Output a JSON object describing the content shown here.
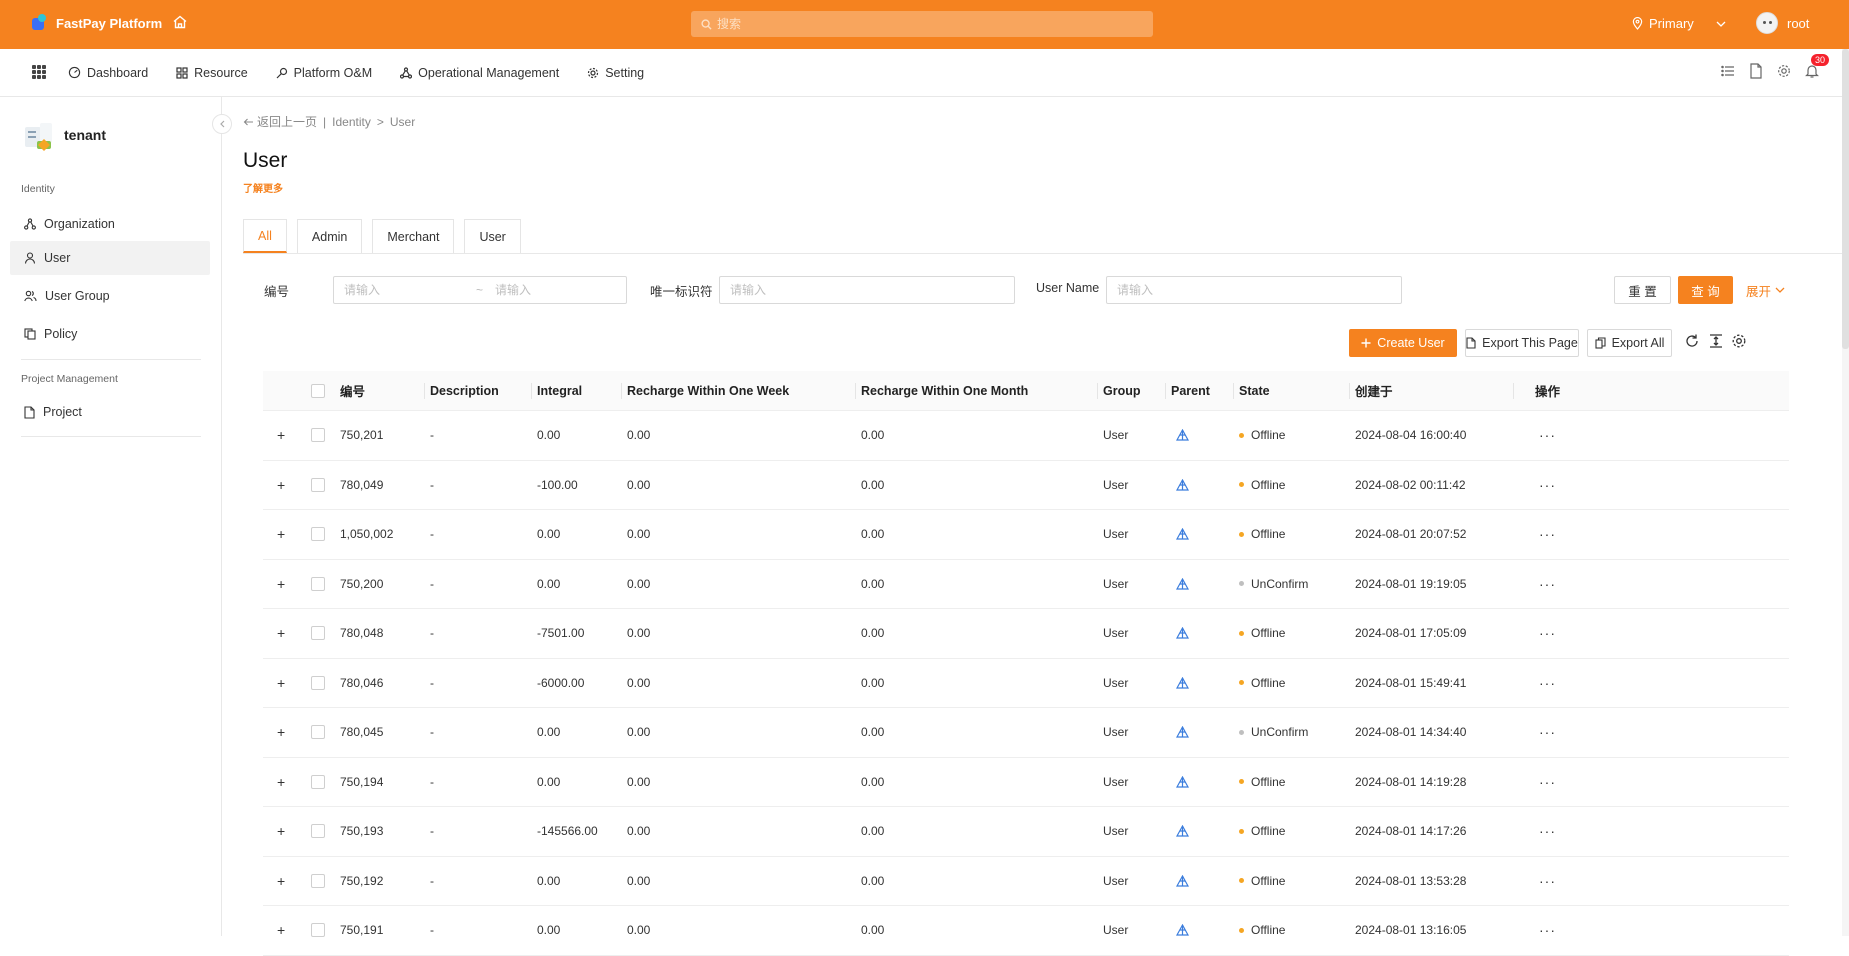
{
  "topbar": {
    "brand": "FastPay Platform",
    "search_placeholder": "搜索",
    "environment": "Primary",
    "username": "root"
  },
  "nav": {
    "items": [
      {
        "label": "Dashboard",
        "icon": "dashboard-icon"
      },
      {
        "label": "Resource",
        "icon": "resource-icon"
      },
      {
        "label": "Platform O&M",
        "icon": "platform-om-icon"
      },
      {
        "label": "Operational Management",
        "icon": "operational-icon"
      },
      {
        "label": "Setting",
        "icon": "gear-icon"
      }
    ],
    "notification_count": "30"
  },
  "sidebar": {
    "tenant": "tenant",
    "groups": [
      {
        "title": "Identity",
        "items": [
          {
            "label": "Organization",
            "icon": "organization-icon",
            "active": false
          },
          {
            "label": "User",
            "icon": "user-icon",
            "active": true
          },
          {
            "label": "User Group",
            "icon": "user-group-icon",
            "active": false
          },
          {
            "label": "Policy",
            "icon": "policy-icon",
            "active": false
          }
        ]
      },
      {
        "title": "Project Management",
        "items": [
          {
            "label": "Project",
            "icon": "project-icon",
            "active": false
          }
        ]
      }
    ]
  },
  "breadcrumb": {
    "back": "返回上一页",
    "separator": "|",
    "items": [
      "Identity",
      "User"
    ],
    "arrow": ">"
  },
  "page": {
    "title": "User",
    "learn_more": "了解更多"
  },
  "tabs": [
    {
      "label": "All",
      "active": true
    },
    {
      "label": "Admin",
      "active": false
    },
    {
      "label": "Merchant",
      "active": false
    },
    {
      "label": "User",
      "active": false
    }
  ],
  "filters": {
    "id_label": "编号",
    "id_from_placeholder": "请输入",
    "range_sep": "~",
    "id_to_placeholder": "请输入",
    "uid_label": "唯一标识符",
    "uid_placeholder": "请输入",
    "username_label": "User Name",
    "username_placeholder": "请输入",
    "reset": "重 置",
    "query": "查 询",
    "expand": "展开"
  },
  "toolbar": {
    "create": "Create User",
    "export_page": "Export This Page",
    "export_all": "Export All"
  },
  "table": {
    "columns": [
      "编号",
      "Description",
      "Integral",
      "Recharge Within One Week",
      "Recharge Within One Month",
      "Group",
      "Parent",
      "State",
      "创建于",
      "操作"
    ],
    "rows": [
      {
        "id": "750,201",
        "desc": "-",
        "integral": "0.00",
        "week": "0.00",
        "month": "0.00",
        "group": "User",
        "state": "Offline",
        "created": "2024-08-04 16:00:40"
      },
      {
        "id": "780,049",
        "desc": "-",
        "integral": "-100.00",
        "week": "0.00",
        "month": "0.00",
        "group": "User",
        "state": "Offline",
        "created": "2024-08-02 00:11:42"
      },
      {
        "id": "1,050,002",
        "desc": "-",
        "integral": "0.00",
        "week": "0.00",
        "month": "0.00",
        "group": "User",
        "state": "Offline",
        "created": "2024-08-01 20:07:52"
      },
      {
        "id": "750,200",
        "desc": "-",
        "integral": "0.00",
        "week": "0.00",
        "month": "0.00",
        "group": "User",
        "state": "UnConfirm",
        "created": "2024-08-01 19:19:05"
      },
      {
        "id": "780,048",
        "desc": "-",
        "integral": "-7501.00",
        "week": "0.00",
        "month": "0.00",
        "group": "User",
        "state": "Offline",
        "created": "2024-08-01 17:05:09"
      },
      {
        "id": "780,046",
        "desc": "-",
        "integral": "-6000.00",
        "week": "0.00",
        "month": "0.00",
        "group": "User",
        "state": "Offline",
        "created": "2024-08-01 15:49:41"
      },
      {
        "id": "780,045",
        "desc": "-",
        "integral": "0.00",
        "week": "0.00",
        "month": "0.00",
        "group": "User",
        "state": "UnConfirm",
        "created": "2024-08-01 14:34:40"
      },
      {
        "id": "750,194",
        "desc": "-",
        "integral": "0.00",
        "week": "0.00",
        "month": "0.00",
        "group": "User",
        "state": "Offline",
        "created": "2024-08-01 14:19:28"
      },
      {
        "id": "750,193",
        "desc": "-",
        "integral": "-145566.00",
        "week": "0.00",
        "month": "0.00",
        "group": "User",
        "state": "Offline",
        "created": "2024-08-01 14:17:26"
      },
      {
        "id": "750,192",
        "desc": "-",
        "integral": "0.00",
        "week": "0.00",
        "month": "0.00",
        "group": "User",
        "state": "Offline",
        "created": "2024-08-01 13:53:28"
      },
      {
        "id": "750,191",
        "desc": "-",
        "integral": "0.00",
        "week": "0.00",
        "month": "0.00",
        "group": "User",
        "state": "Offline",
        "created": "2024-08-01 13:16:05"
      }
    ]
  },
  "colors": {
    "accent": "#f5821f",
    "offline_dot": "#f5a623",
    "unconfirm_dot": "#bfbfbf",
    "parent_icon": "#3b7ddd"
  }
}
